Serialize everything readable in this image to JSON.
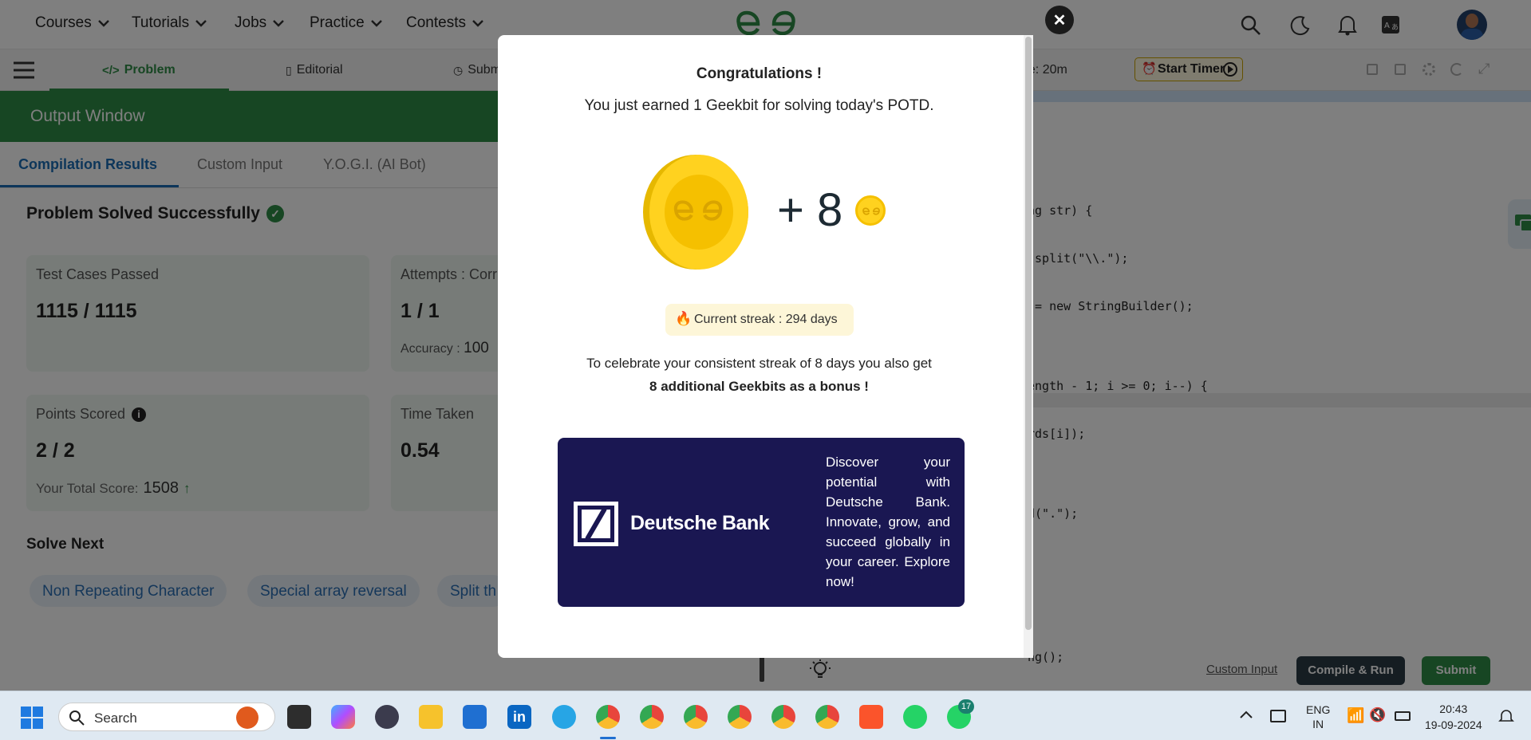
{
  "nav": {
    "items": [
      "Courses",
      "Tutorials",
      "Jobs",
      "Practice",
      "Contests"
    ],
    "logo_icon": "gfg-logo-icon"
  },
  "problem_tabs": {
    "problem": "Problem",
    "editorial": "Editorial",
    "submissions": "Submi",
    "timer_text": "ne: 20m",
    "start_timer": "Start Timer"
  },
  "output": {
    "title": "Output Window",
    "tabs": [
      "Compilation Results",
      "Custom Input",
      "Y.O.G.I. (AI Bot)"
    ],
    "status": "Problem Solved Successfully",
    "cards": {
      "test_label": "Test Cases Passed",
      "test_value": "1115 / 1115",
      "attempts_label": "Attempts : Corr",
      "attempts_value": "1 / 1",
      "accuracy_label": "Accuracy :",
      "accuracy_value": "100",
      "points_label": "Points Scored",
      "points_value": "2 / 2",
      "total_label": "Your Total Score:",
      "total_value": "1508",
      "time_label": "Time Taken",
      "time_value": "0.54"
    },
    "solve_next": "Solve Next",
    "chips": [
      "Non Repeating Character",
      "Special array reversal",
      "Split th"
    ]
  },
  "editor": {
    "lines": [
      "ng str) {",
      ".split(\"\\\\.\");",
      " = new StringBuilder();",
      "",
      "ength - 1; i >= 0; i--) {",
      "rds[i]);",
      "",
      "d(\".\");",
      "",
      "",
      "",
      "ng();"
    ],
    "custom_input": "Custom Input",
    "compile_run": "Compile & Run",
    "submit": "Submit"
  },
  "modal": {
    "congrats": "Congratulations !",
    "earned": "You just earned 1 Geekbit for solving today's POTD.",
    "plus": "+ 8",
    "streak": "Current streak : 294 days",
    "celebrate": "To celebrate your consistent streak of 8 days you also get",
    "bonus": "8 additional Geekbits as a bonus !",
    "ad_brand": "Deutsche Bank",
    "ad_text": "Discover your potential with Deutsche Bank. Innovate, grow, and succeed globally in your career. Explore now!",
    "close": "✕"
  },
  "taskbar": {
    "search": "Search",
    "lang1": "ENG",
    "lang2": "IN",
    "time": "20:43",
    "date": "19-09-2024",
    "whatsapp_badge": "17"
  },
  "colors": {
    "gfg_green": "#2f8d46",
    "modal_ad_bg": "#1a1752",
    "submit_green": "#2f8d46"
  }
}
